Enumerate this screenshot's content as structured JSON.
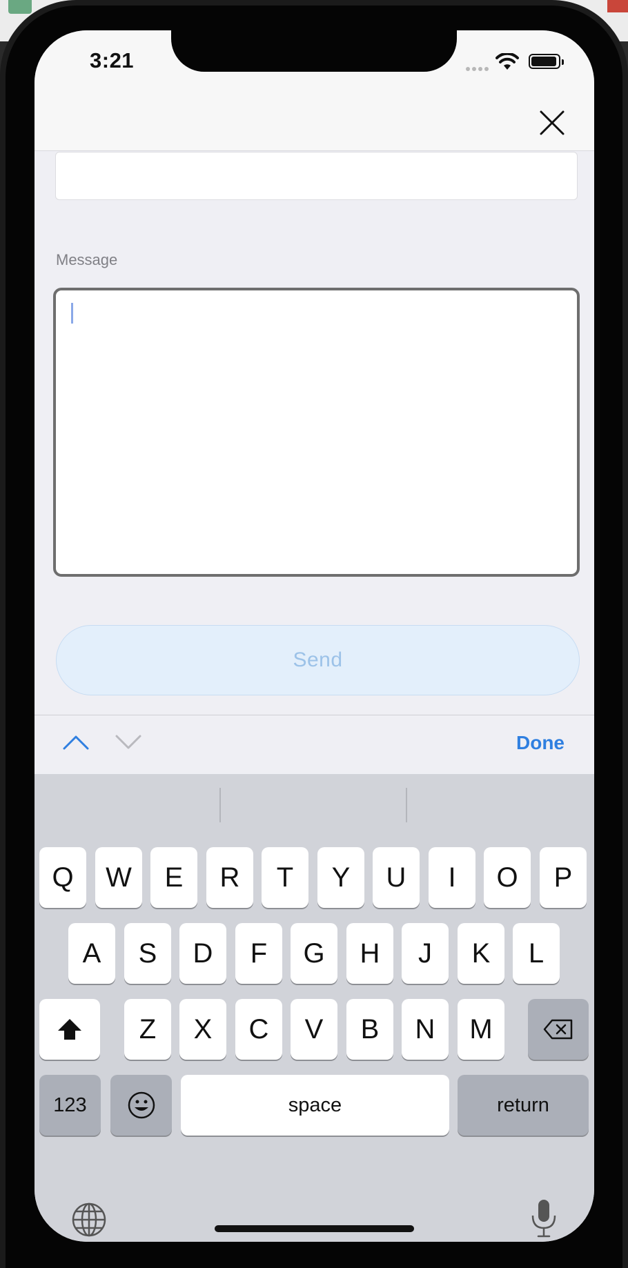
{
  "status_bar": {
    "time": "3:21"
  },
  "form": {
    "message_label": "Message",
    "message_value": "",
    "send_label": "Send"
  },
  "accessory": {
    "done_label": "Done"
  },
  "keyboard": {
    "row1": [
      "Q",
      "W",
      "E",
      "R",
      "T",
      "Y",
      "U",
      "I",
      "O",
      "P"
    ],
    "row2": [
      "A",
      "S",
      "D",
      "F",
      "G",
      "H",
      "J",
      "K",
      "L"
    ],
    "row3": [
      "Z",
      "X",
      "C",
      "V",
      "B",
      "N",
      "M"
    ],
    "numbers_label": "123",
    "space_label": "space",
    "return_label": "return"
  },
  "icons": [
    "close-icon",
    "shift-icon",
    "backspace-icon",
    "emoji-icon",
    "globe-icon",
    "microphone-icon",
    "chevron-up-icon",
    "chevron-down-icon",
    "wifi-icon",
    "battery-icon",
    "signal-icon"
  ],
  "colors": {
    "accent": "#2f7fe0",
    "send_bg": "#e3effb",
    "send_text": "#9cc2e8",
    "keyboard_bg": "#d1d3d9"
  }
}
